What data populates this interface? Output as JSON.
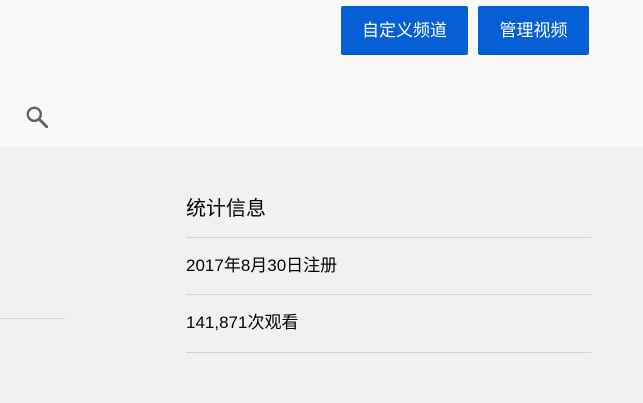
{
  "header": {
    "customize_channel_label": "自定义频道",
    "manage_videos_label": "管理视频",
    "search_icon": "search-icon"
  },
  "stats": {
    "title": "统计信息",
    "joined": "2017年8月30日注册",
    "views": "141,871次观看"
  },
  "colors": {
    "button_bg": "#065fd4",
    "button_text": "#ffffff",
    "header_bg": "#f9f9f9",
    "content_bg": "#f1f1f1",
    "divider": "#d3d3d3",
    "text": "#030303"
  }
}
